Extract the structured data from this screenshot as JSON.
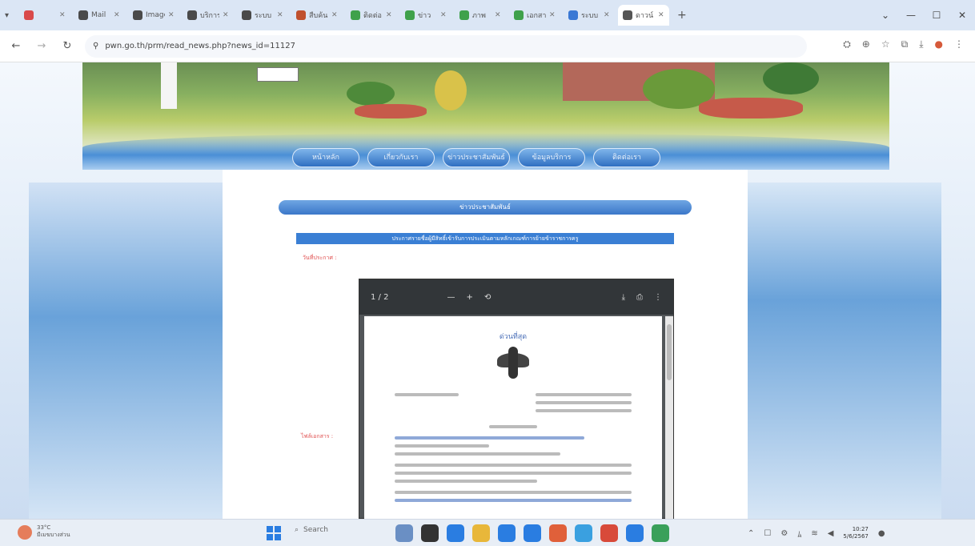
{
  "browser": {
    "tabs": [
      {
        "label": "",
        "fav": "#d94a4a"
      },
      {
        "label": "Mail",
        "fav": "#4a4a4a"
      },
      {
        "label": "Imagen",
        "fav": "#4a4a4a"
      },
      {
        "label": "บริการ",
        "fav": "#4a4a4a"
      },
      {
        "label": "ระบบ",
        "fav": "#4a4a4a"
      },
      {
        "label": "สืบค้น",
        "fav": "#c0502e"
      },
      {
        "label": "ติดต่อ",
        "fav": "#3fa14b"
      },
      {
        "label": "ข่าว",
        "fav": "#3fa14b"
      },
      {
        "label": "ภาพ",
        "fav": "#3fa14b"
      },
      {
        "label": "เอกสาร",
        "fav": "#3fa14b"
      },
      {
        "label": "ระบบ",
        "fav": "#3a78d4"
      },
      {
        "label": "ดาวน์",
        "fav": "#555555",
        "active": true
      }
    ],
    "new_tab": "+",
    "url": "pwn.go.th/prm/read_news.php?news_id=11127",
    "window_controls": [
      "⌄",
      "—",
      "☐",
      "✕"
    ]
  },
  "site": {
    "nav": [
      "หน้าหลัก",
      "เกี่ยวกับเรา",
      "ข่าวประชาสัมพันธ์",
      "ข้อมูลบริการ",
      "ติดต่อเรา"
    ],
    "section_header": "ข่าวประชาสัมพันธ์",
    "news_title": "ประกาศรายชื่อผู้มีสิทธิ์เข้ารับการประเมินตามหลักเกณฑ์การย้ายข้าราชการครู",
    "date_label": "วันที่ประกาศ :",
    "attachment_label": "ไฟล์เอกสาร :"
  },
  "pdf": {
    "page_indicator": "1 / 2",
    "doc_heading": "ด่วนที่สุด",
    "toolbar_icons": [
      "minus-icon",
      "plus-icon",
      "rotate-icon",
      "download-icon",
      "print-icon",
      "more-icon"
    ]
  },
  "taskbar": {
    "weather_temp": "33°C",
    "weather_desc": "มีเมฆบางส่วน",
    "search_placeholder": "Search",
    "time": "10:27",
    "date": "5/6/2567",
    "app_colors": [
      "#6a8fc4",
      "#333333",
      "#2a7de1",
      "#e8b73a",
      "#2a7de1",
      "#2a7de1",
      "#e0603a",
      "#3aa0e0",
      "#d84a3a",
      "#2a7de1",
      "#3aa05a"
    ]
  }
}
